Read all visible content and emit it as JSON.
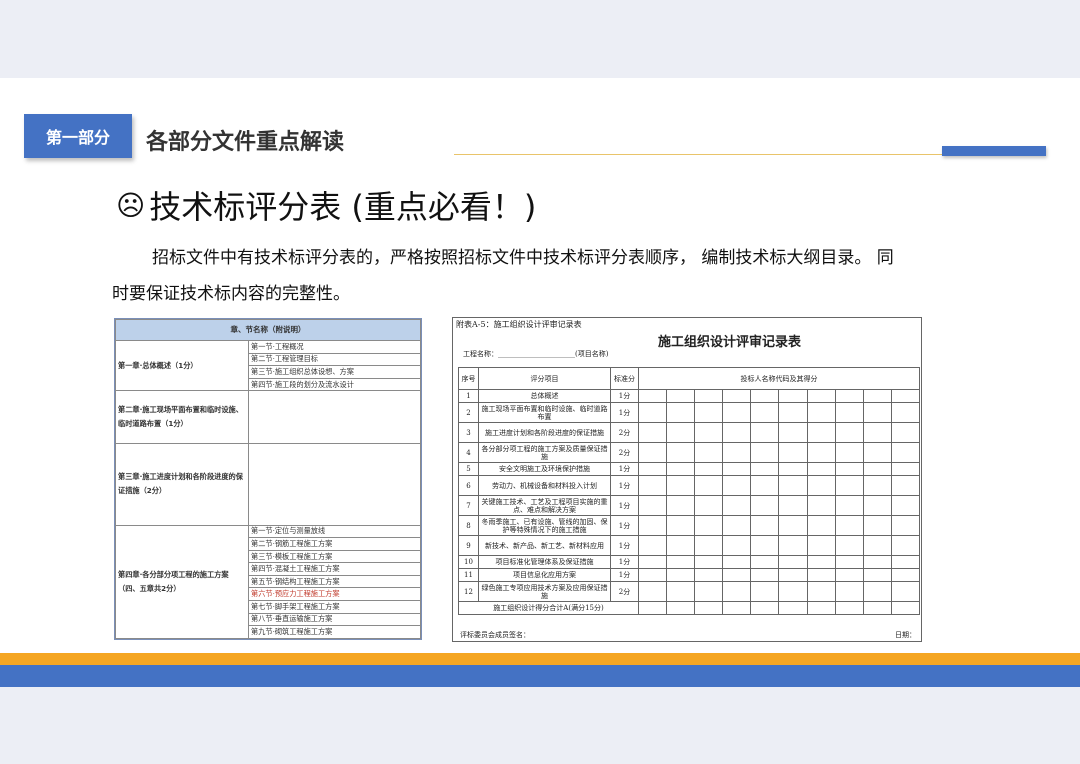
{
  "header": {
    "section_tag": "第一部分",
    "section_title": "各部分文件重点解读"
  },
  "content": {
    "heading": "技术标评分表 (重点必看！)",
    "paragraph": "招标文件中有技术标评分表的，严格按照招标文件中技术标评分表顺序， 编制技术标大纲目录。 同时要保证技术标内容的完整性。"
  },
  "left_doc": {
    "header": "章、节名称（附说明）",
    "chapters": [
      {
        "title": "第一章·总体概述（1分）",
        "sections": [
          "第一节·工程概况",
          "第二节·工程管理目标",
          "第三节·施工组织总体设想、方案",
          "第四节·施工段的划分及流水设计"
        ]
      },
      {
        "title": "第二章·施工现场平面布置和临时设施、临时道路布置（1分）",
        "sections": []
      },
      {
        "title": "第三章·施工进度计划和各阶段进度的保证措施（2分）",
        "sections": []
      },
      {
        "title": "第四章·各分部分项工程的施工方案（四、五章共2分）",
        "sections": [
          "第一节·定位与测量放线",
          "第二节·钢筋工程施工方案",
          "第三节·模板工程施工方案",
          "第四节·混凝土工程施工方案",
          "第五节·钢结构工程施工方案",
          "第六节·预应力工程施工方案",
          "第七节·脚手架工程施工方案",
          "第八节·垂直运输施工方案",
          "第九节·砌筑工程施工方案"
        ]
      }
    ],
    "red_section": "第六节·预应力工程施工方案"
  },
  "right_doc": {
    "caption": "附表A-5：施工组织设计评审记录表",
    "title": "施工组织设计评审记录表",
    "project_label": "工程名称：______________________(项目名称)",
    "col_no": "序号",
    "col_item": "评分项目",
    "col_std": "标准分",
    "col_bidders": "投标人名称代码及其得分",
    "rows": [
      {
        "no": "1",
        "item": "总体概述",
        "std": "1分"
      },
      {
        "no": "2",
        "item": "施工现场平面布置和临时设施、临时道路布置",
        "std": "1分"
      },
      {
        "no": "3",
        "item": "施工进度计划和各阶段进度的保证措施",
        "std": "2分"
      },
      {
        "no": "4",
        "item": "各分部分项工程的施工方案及质量保证措施",
        "std": "2分"
      },
      {
        "no": "5",
        "item": "安全文明施工及环境保护措施",
        "std": "1分"
      },
      {
        "no": "6",
        "item": "劳动力、机械设备和材料投入计划",
        "std": "1分"
      },
      {
        "no": "7",
        "item": "关键施工技术、工艺及工程项目实施的重点、难点和解决方案",
        "std": "1分"
      },
      {
        "no": "8",
        "item": "冬雨季施工、已有设施、管线的加固、保护等特殊情况下的施工措施",
        "std": "1分"
      },
      {
        "no": "9",
        "item": "新技术、新产品、新工艺、新材料应用",
        "std": "1分"
      },
      {
        "no": "10",
        "item": "项目标准化管理体系及保证措施",
        "std": "1分"
      },
      {
        "no": "11",
        "item": "项目信息化应用方案",
        "std": "1分"
      },
      {
        "no": "12",
        "item": "绿色施工专项应用技术方案及应用保证措施",
        "std": "2分"
      }
    ],
    "total": "施工组织设计得分合计A(满分15分)",
    "footer_left": "评标委员会成员签名：",
    "footer_right": "日期："
  },
  "colors": {
    "brand_blue": "#4472c4",
    "accent_orange": "#f5a623"
  }
}
